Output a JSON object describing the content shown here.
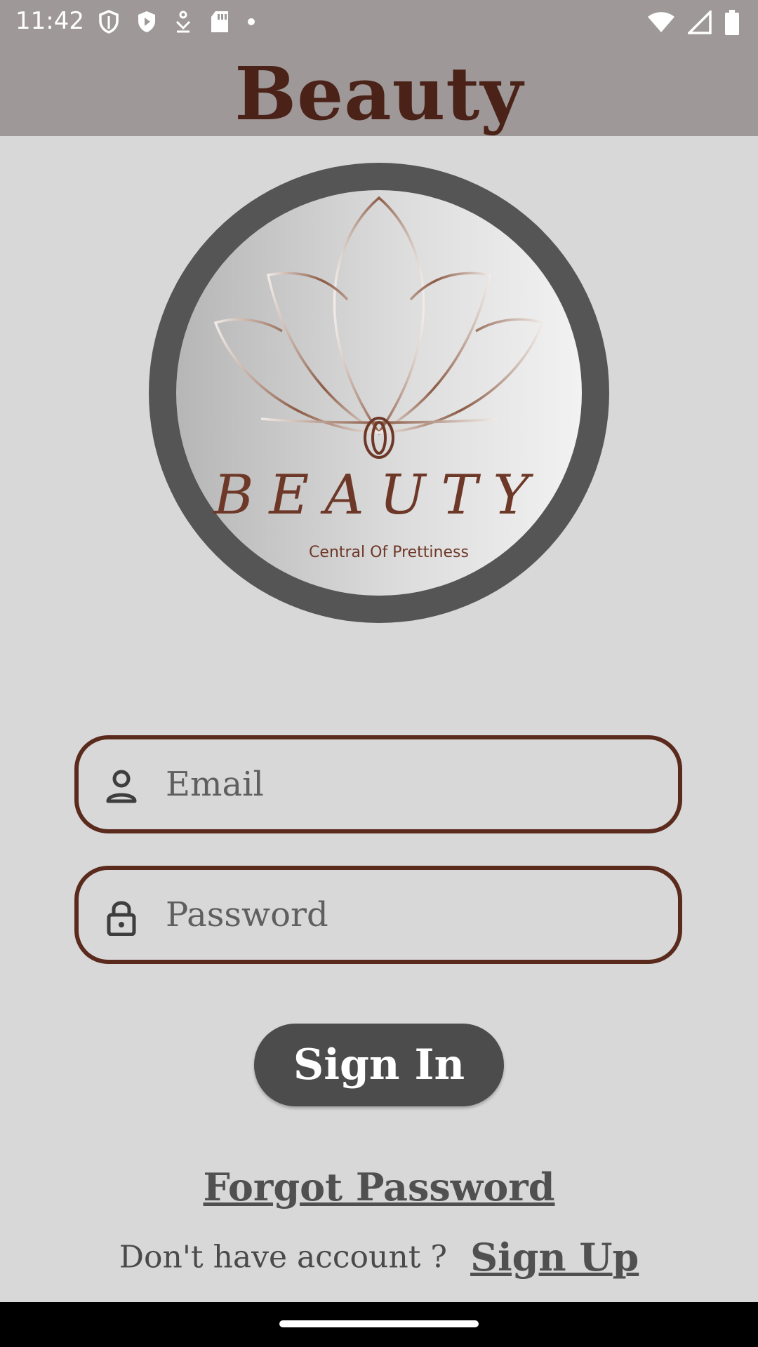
{
  "status_bar": {
    "time": "11:42",
    "icons": [
      "shield-outline-icon",
      "shield-filled-icon",
      "download-icon",
      "sd-card-icon",
      "dot-icon",
      "wifi-icon",
      "signal-icon",
      "battery-icon"
    ]
  },
  "app_bar": {
    "title": "Beauty"
  },
  "logo": {
    "brand": "BEAUTY",
    "tagline": "Central Of Prettiness"
  },
  "form": {
    "email": {
      "placeholder": "Email",
      "value": "",
      "icon": "person-icon"
    },
    "password": {
      "placeholder": "Password",
      "value": "",
      "icon": "lock-icon"
    },
    "sign_in_label": "Sign In"
  },
  "links": {
    "forgot_password": "Forgot Password",
    "no_account_text": "Don't have account ?",
    "sign_up": "Sign Up"
  },
  "colors": {
    "app_bar_bg": "#9f9898",
    "page_bg": "#d9d8d9",
    "brand_brown": "#4a2218",
    "field_border": "#5a2a1d",
    "button_bg": "#4c4c4c"
  }
}
